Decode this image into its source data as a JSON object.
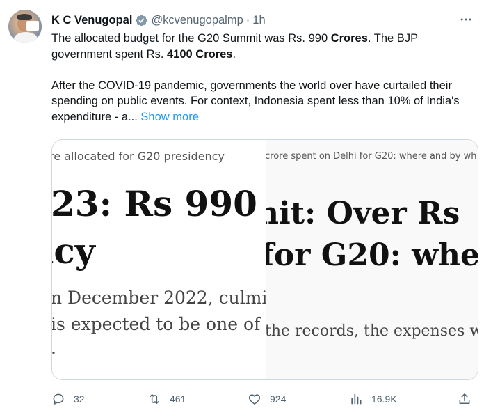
{
  "tweet": {
    "author_name": "K C Venugopal",
    "handle": "@kcvenugopalmp",
    "separator": "·",
    "time": "1h",
    "more_icon": "more-horizontal-icon",
    "verified_icon": "verified-badge-icon",
    "text": {
      "line1_a": "The allocated budget for the G20 Summit was Rs. 990 ",
      "line1_b": "Crores",
      "line1_c": ". The BJP",
      "line2_a": "government spent Rs. ",
      "line2_b": "4100 Crores",
      "line2_c": ".",
      "para2": "After the COVID-19 pandemic, governments the world over have curtailed their spending on public events. For context, Indonesia spent less than 10% of India's expenditure - a...",
      "show_more": "Show more"
    }
  },
  "media": {
    "left": {
      "caption": "re allocated for G20 presidency",
      "headline1": "23: Rs 990",
      "headline2": "ncy",
      "body1": "n December 2022, culmi",
      "body2": " is expected to be one of",
      "body3": "."
    },
    "right": {
      "caption": "crore spent on Delhi for G20: where and by wh",
      "headline1": "nit: Over Rs",
      "headline2": "for G20: whe",
      "body1": "the records, the expenses w"
    }
  },
  "actions": {
    "replies": "32",
    "reposts": "461",
    "likes": "924",
    "views": "16.9K",
    "icons": [
      "reply-icon",
      "repost-icon",
      "like-icon",
      "views-icon",
      "share-icon"
    ]
  },
  "colors": {
    "text": "#0f1419",
    "secondary": "#536471",
    "link": "#1d9bf0",
    "verified": "#829aab",
    "border": "#cfd9de"
  }
}
